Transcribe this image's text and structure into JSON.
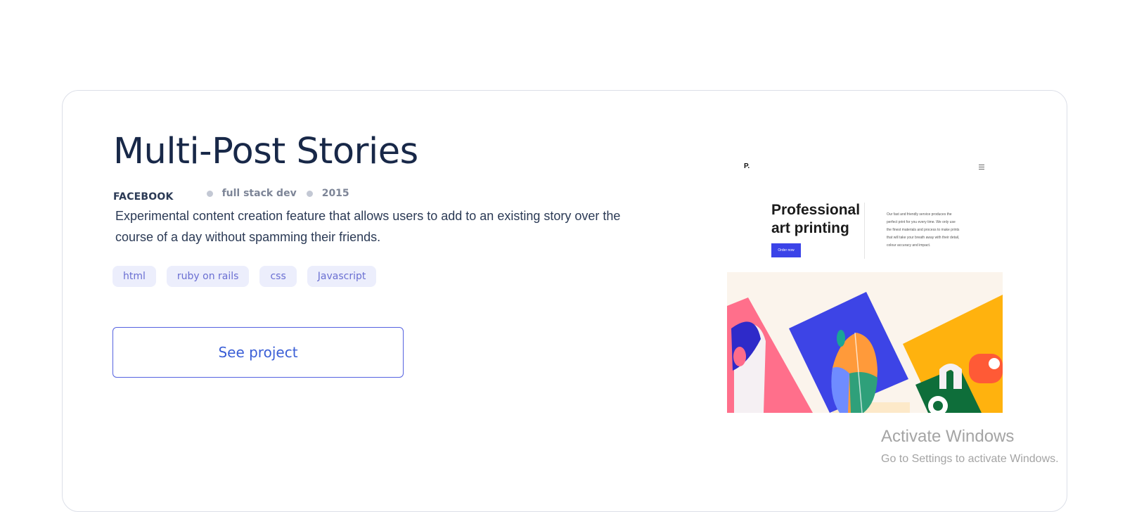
{
  "project": {
    "title": "Multi-Post Stories",
    "company": "FACEBOOK",
    "role": "full stack dev",
    "year": "2015",
    "description": "Experimental content creation feature that allows users to add to an existing story over the course of a day without spamming their friends.",
    "tags": [
      "html",
      "ruby on rails",
      "css",
      "Javascript"
    ],
    "cta_label": "See project"
  },
  "preview": {
    "logo": "P.",
    "headline_line1": "Professional",
    "headline_line2": "art printing",
    "button": "Order now",
    "body": "Our fast and friendly service produces the perfect print for you every time. We only use the finest materials and process to make prints that will take your breath away with their detail, colour accuracy and impact."
  },
  "watermark": {
    "title": "Activate Windows",
    "subtitle": "Go to Settings to activate Windows."
  },
  "colors": {
    "title": "#182848",
    "accent": "#3b5fd6",
    "tag_bg": "#eceefc",
    "tag_text": "#6a6fd2"
  }
}
